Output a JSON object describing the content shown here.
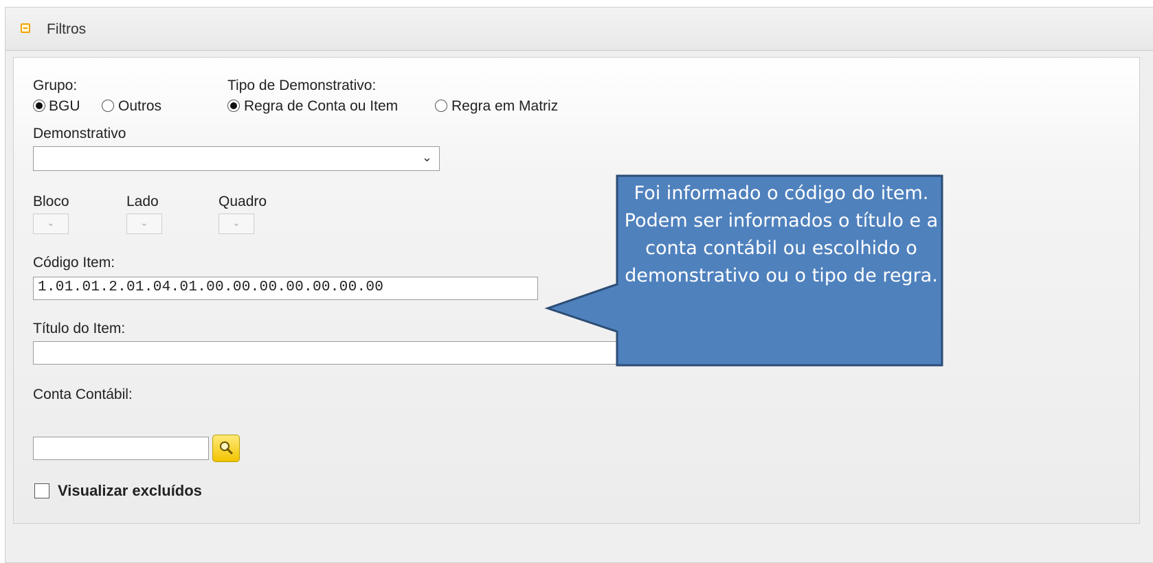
{
  "panel": {
    "title": "Filtros",
    "toggle_icon": "collapse-minus-icon"
  },
  "grupo": {
    "label": "Grupo:",
    "options": [
      {
        "label": "BGU",
        "selected": true
      },
      {
        "label": "Outros",
        "selected": false
      }
    ]
  },
  "tipo": {
    "label": "Tipo de Demonstrativo:",
    "options": [
      {
        "label": "Regra de Conta ou Item",
        "selected": true
      },
      {
        "label": "Regra em Matriz",
        "selected": false
      }
    ]
  },
  "demonstrativo": {
    "label": "Demonstrativo",
    "value": ""
  },
  "bloco": {
    "label": "Bloco"
  },
  "lado": {
    "label": "Lado"
  },
  "quadro": {
    "label": "Quadro"
  },
  "codigo": {
    "label": "Código Item:",
    "value": "1.01.01.2.01.04.01.00.00.00.00.00.00.00"
  },
  "titulo": {
    "label": "Título do Item:",
    "value": ""
  },
  "conta": {
    "label": "Conta Contábil:",
    "value": "",
    "search_icon": "magnifier-icon"
  },
  "excluidos": {
    "label": "Visualizar excluídos",
    "checked": false
  },
  "callout": {
    "text": "Foi informado o código do item. Podem ser informados o título e a conta contábil ou escolhido o demonstrativo ou o tipo de regra.",
    "fill": "#4f81bd",
    "border": "#2c4d75"
  }
}
